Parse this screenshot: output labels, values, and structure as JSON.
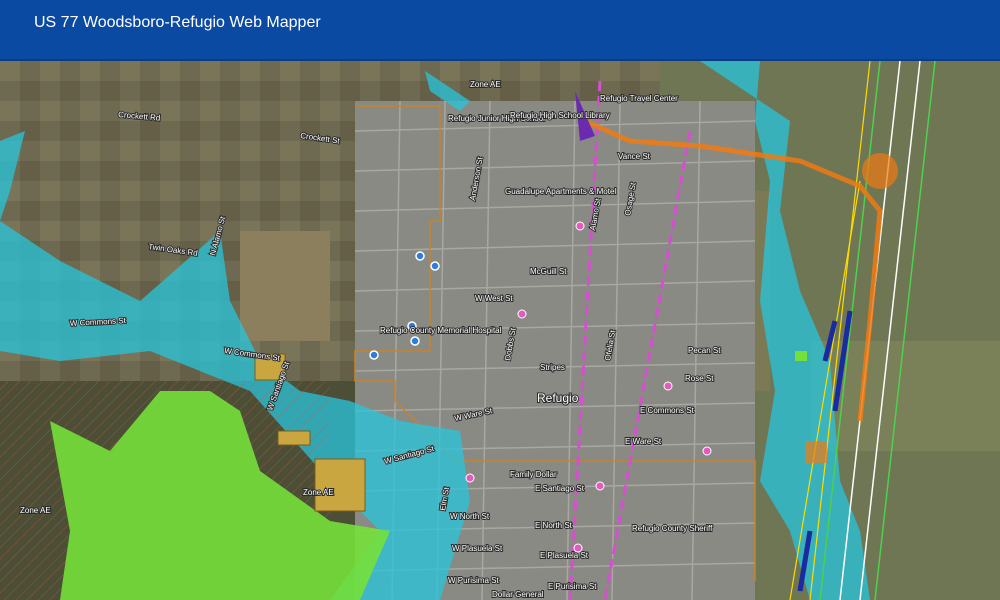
{
  "header": {
    "title": "US 77 Woodsboro-Refugio Web Mapper"
  },
  "map": {
    "city_label": "Refugio",
    "zone_labels": [
      "Zone AE",
      "Zone AE",
      "Zone AE"
    ],
    "road_labels": [
      "Crockett Rd",
      "Crockett St",
      "W Commons St",
      "W Commons St",
      "Twin Oaks Rd",
      "N Alamo St",
      "W Santiago St",
      "W Santiago St",
      "W West St",
      "W Ware St",
      "W North St",
      "W Plasuela St",
      "W Purisima St",
      "E Commons St",
      "E Ware St",
      "E North St",
      "E Plasuela St",
      "E Santiago St",
      "E Purisima St",
      "Vance St",
      "McGuill St",
      "Pecan St",
      "Rose St",
      "Anderson St",
      "Osage St",
      "Alamo St",
      "Elm St",
      "Ofelia St",
      "Dobbs St"
    ],
    "poi_labels": [
      "Refugio Travel Center",
      "Refugio Junior High School",
      "Refugio High School Library",
      "Guadalupe Apartments & Motel",
      "Refugio County Memorial Hospital",
      "Refugio County Sheriff",
      "Family Dollar",
      "Stripes",
      "Dollar General"
    ],
    "colors": {
      "header": "#0b4aa2",
      "floodplain": "#27c5dc",
      "green_area": "#74e03a",
      "parcels": "#c9a640",
      "highway_corridor": "#f07a12",
      "railroad": "#d64fd1",
      "city_limit": "#c8832a"
    }
  }
}
